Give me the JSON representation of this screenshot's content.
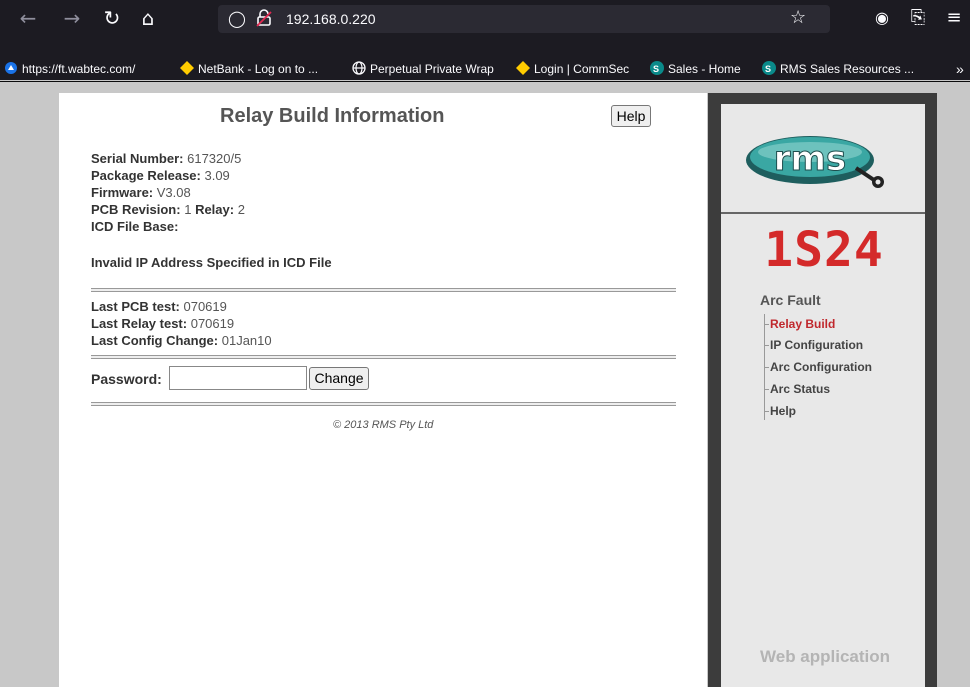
{
  "browser": {
    "url": "192.168.0.220",
    "bookmarks": [
      {
        "label": "https://ft.wabtec.com/",
        "icon": "globe-icon"
      },
      {
        "label": "NetBank - Log on to ...",
        "icon": "diamond-icon"
      },
      {
        "label": "Perpetual Private Wrap",
        "icon": "globe-icon"
      },
      {
        "label": "Login | CommSec",
        "icon": "diamond-icon"
      },
      {
        "label": "Sales - Home",
        "icon": "sharepoint-icon"
      },
      {
        "label": "RMS Sales Resources ...",
        "icon": "sharepoint-icon"
      }
    ]
  },
  "page": {
    "title": "Relay Build Information",
    "help_label": "Help",
    "serial_label": "Serial Number:",
    "serial_value": "617320/5",
    "package_label": "Package Release:",
    "package_value": "3.09",
    "firmware_label": "Firmware:",
    "firmware_value": "V3.08",
    "pcb_label": "PCB Revision:",
    "pcb_value": "1",
    "relay_label": "Relay:",
    "relay_value": "2",
    "icd_label": "ICD File Base:",
    "icd_error": "Invalid IP Address Specified in ICD File",
    "last_pcb_label": "Last PCB test:",
    "last_pcb_value": "070619",
    "last_relay_label": "Last Relay test:",
    "last_relay_value": "070619",
    "last_config_label": "Last Config Change:",
    "last_config_value": "01Jan10",
    "password_label": "Password:",
    "password_value": "",
    "change_label": "Change",
    "copyright": "© 2013 RMS Pty Ltd"
  },
  "panel": {
    "logo_text": "rms",
    "model": "1S24",
    "section": "Arc Fault",
    "menu": [
      {
        "label": "Relay Build",
        "active": true
      },
      {
        "label": "IP Configuration",
        "active": false
      },
      {
        "label": "Arc Configuration",
        "active": false
      },
      {
        "label": "Arc Status",
        "active": false
      },
      {
        "label": "Help",
        "active": false
      }
    ],
    "footer": "Web application"
  },
  "colors": {
    "accent_red": "#d42a2a",
    "menu_active": "#c0282d",
    "logo_teal": "#2a8f8f"
  }
}
